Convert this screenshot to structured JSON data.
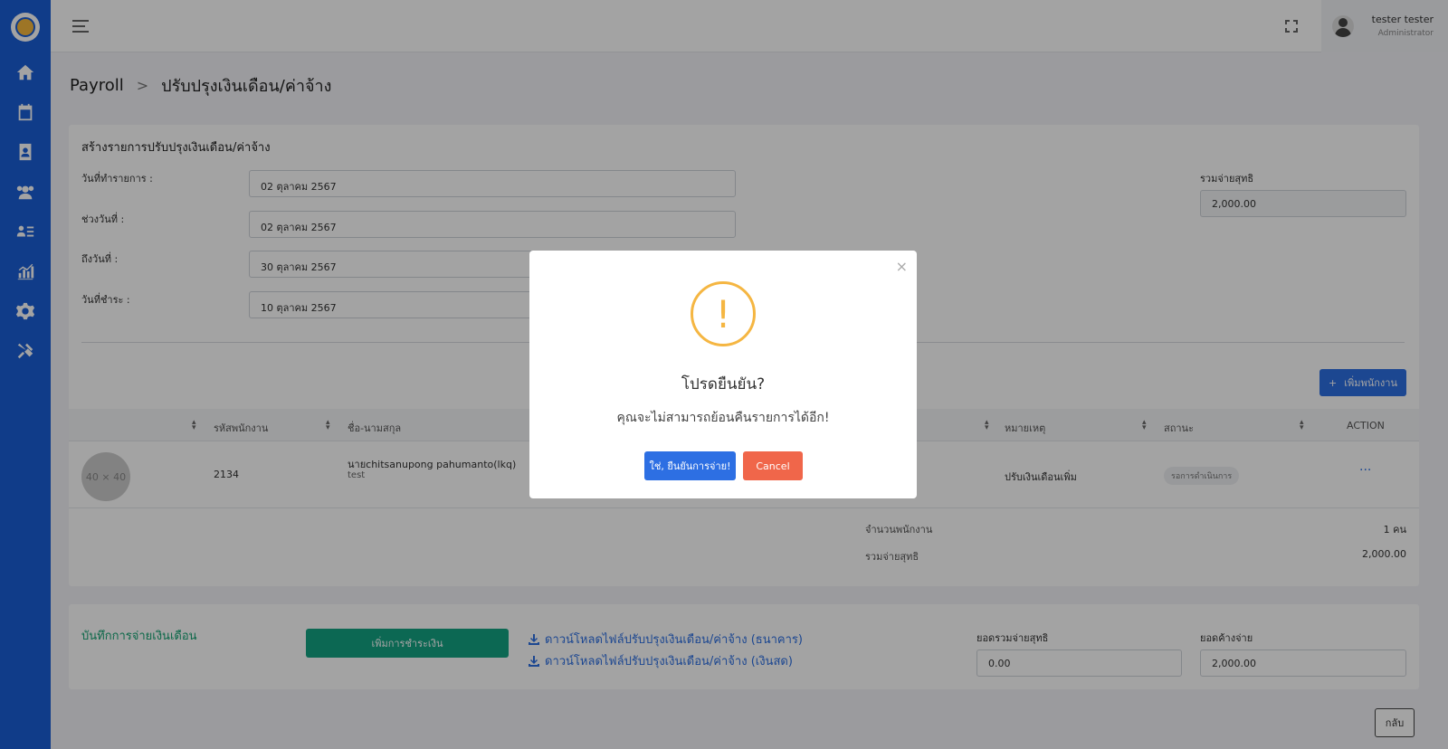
{
  "header": {
    "user_name": "tester tester",
    "user_role": "Administrator"
  },
  "breadcrumb": {
    "root": "Payroll",
    "separator": ">",
    "current": "ปรับปรุงเงินเดือน/ค่าจ้าง"
  },
  "form": {
    "title": "สร้างรายการปรับปรุงเงินเดือน/ค่าจ้าง",
    "transaction_date_label": "วันที่ทำรายการ :",
    "transaction_date_value": "02 ตุลาคม 2567",
    "period_start_label": "ช่วงวันที่ :",
    "period_start_value": "02 ตุลาคม 2567",
    "period_end_label": "ถึงวันที่ :",
    "period_end_value": "30 ตุลาคม 2567",
    "payment_date_label": "วันที่ชำระ :",
    "payment_date_value": "10 ตุลาคม 2567",
    "net_total_label": "รวมจ่ายสุทธิ",
    "net_total_value": "2,000.00",
    "add_employee_label": "เพิ่มพนักงาน",
    "add_employee_icon": "+"
  },
  "table": {
    "columns": [
      "รหัสพนักงาน",
      "ชื่อ-นามสกุล",
      "หมายเหตุ",
      "สถานะ",
      "ACTION"
    ],
    "rows": [
      {
        "avatar_placeholder": "40 × 40",
        "employee_id": "2134",
        "name": "นายchitsanupong pahumanto(lkq)",
        "subtext": "test",
        "remark": "ปรับเงินเดือนเพิ่ม",
        "status": "รอการดำเนินการ",
        "action": "···"
      }
    ]
  },
  "summary": {
    "employee_count_label": "จำนวนพนักงาน",
    "employee_count_value": "1 คน",
    "net_total_label": "รวมจ่ายสุทธิ",
    "net_total_value": "2,000.00"
  },
  "payment": {
    "title": "บันทึกการจ่ายเงินเดือน",
    "add_payment_label": "เพิ่มการชำระเงิน",
    "download_bank_label": "ดาวน์โหลดไฟล์ปรับปรุงเงินเดือน/ค่าจ้าง (ธนาคาร)",
    "download_cash_label": "ดาวน์โหลดไฟล์ปรับปรุงเงินเดือน/ค่าจ้าง (เงินสด)",
    "total_paid_label": "ยอดรวมจ่ายสุทธิ",
    "total_paid_value": "0.00",
    "outstanding_label": "ยอดค้างจ่าย",
    "outstanding_value": "2,000.00"
  },
  "back_label": "กลับ",
  "modal": {
    "close": "×",
    "icon": "!",
    "title": "โปรดยืนยัน?",
    "text": "คุณจะไม่สามารถย้อนคืนรายการได้อีก!",
    "confirm_label": "ใช่, ยืนยันการจ่าย!",
    "cancel_label": "Cancel"
  },
  "colors": {
    "sidebar": "#1a5fd6",
    "primary": "#2d6fe3",
    "success": "#14a383",
    "danger": "#f0664a",
    "warning": "#f5b642"
  },
  "icons": [
    "home-icon",
    "calendar-money-icon",
    "contacts-icon",
    "users-gear-icon",
    "user-list-icon",
    "chart-icon",
    "gear-icon",
    "tools-icon",
    "download-icon",
    "fullscreen-icon",
    "menu-icon"
  ]
}
